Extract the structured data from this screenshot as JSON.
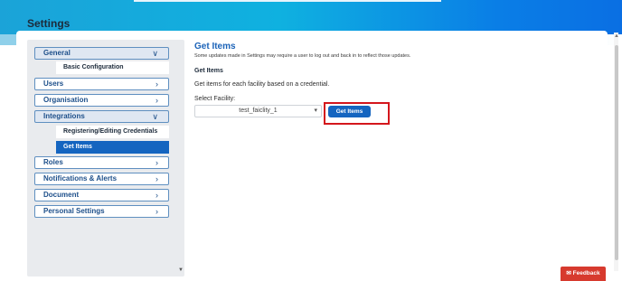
{
  "header": {
    "title": "Settings"
  },
  "sidebar": {
    "items": [
      {
        "label": "General",
        "chevron": "∨"
      },
      {
        "label": "Users",
        "chevron": "›"
      },
      {
        "label": "Organisation",
        "chevron": "›"
      },
      {
        "label": "Integrations",
        "chevron": "∨"
      },
      {
        "label": "Roles",
        "chevron": "›"
      },
      {
        "label": "Notifications & Alerts",
        "chevron": "›"
      },
      {
        "label": "Document",
        "chevron": "›"
      },
      {
        "label": "Personal Settings",
        "chevron": "›"
      }
    ],
    "general_sub": [
      "Basic Configuration"
    ],
    "integrations_sub": [
      "Registering/Editing Credentials",
      "Get Items"
    ],
    "active_sub": "Get Items"
  },
  "main": {
    "title": "Get Items",
    "notice": "Some updates made in Settings may require a user to log out and back in to reflect those updates.",
    "section_title": "Get Items",
    "description": "Get items for each facility based on a credential.",
    "facility_label": "Select Facility:",
    "facility_value": "test_faiclity_1",
    "button_label": "Get Items"
  },
  "feedback": {
    "label": "Feedback",
    "icon": "chat-icon"
  },
  "colors": {
    "accent": "#1565c0",
    "highlight": "#d4161c",
    "feedback": "#d73a2e"
  }
}
